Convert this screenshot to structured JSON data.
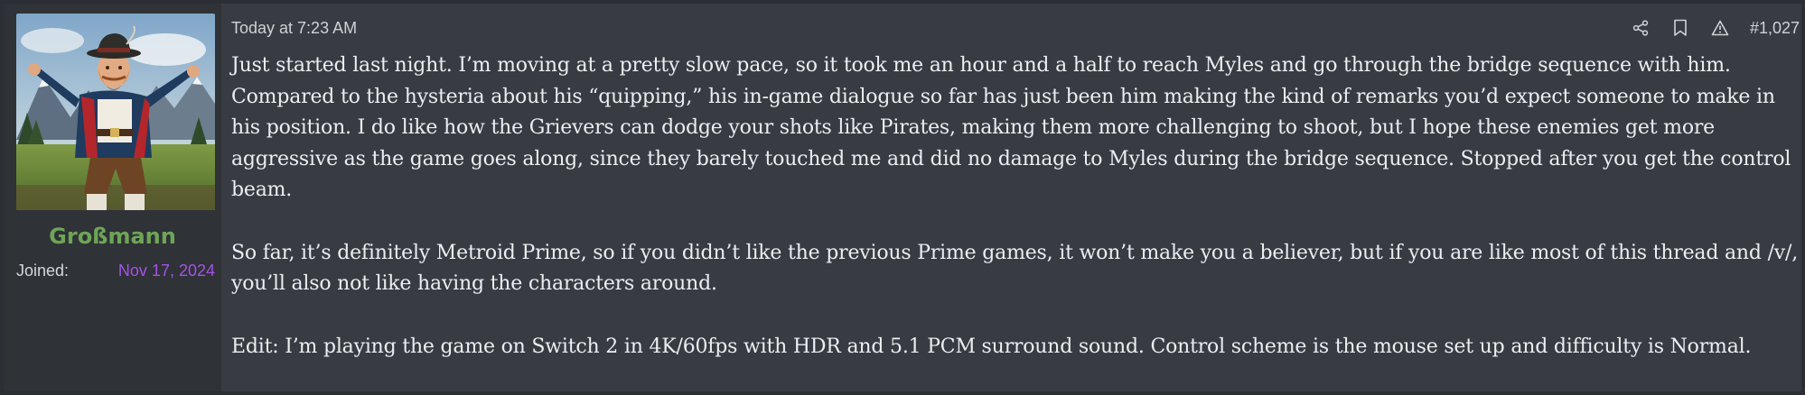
{
  "user": {
    "username": "Großmann",
    "joined_label": "Joined:",
    "joined_date": "Nov 17, 2024",
    "avatar_icon": "avatar-bavarian-man"
  },
  "post": {
    "timestamp": "Today at 7:23 AM",
    "post_number": "#1,027",
    "actions": [
      "share-icon",
      "bookmark-icon",
      "report-icon"
    ],
    "paragraphs": [
      "Just started last night. I’m moving at a pretty slow pace, so it took me an hour and a half to reach Myles and go through the bridge sequence with him. Compared to the hysteria about his “quipping,” his in-game dialogue so far has just been him making the kind of remarks you’d expect someone to make in his position. I do like how the Grievers can dodge your shots like Pirates, making them more challenging to shoot, but I hope these enemies get more aggressive as the game goes along, since they barely touched me and did no damage to Myles during the bridge sequence. Stopped after you get the control beam.",
      "So far, it’s definitely Metroid Prime, so if you didn’t like the previous Prime games, it won’t make you a believer, but if you are like most of this thread and /v/, you’ll also not like having the characters around.",
      "Edit: I’m playing the game on Switch 2 in 4K/60fps with HDR and 5.1 PCM surround sound. Control scheme is the mouse set up and difficulty is Normal."
    ]
  },
  "colors": {
    "page_bg": "#2b2e34",
    "post_bg": "#383b42",
    "user_col_bg": "#2f3237",
    "username": "#6ea556",
    "joined_date": "#a453e6",
    "text": "#eceef0"
  }
}
